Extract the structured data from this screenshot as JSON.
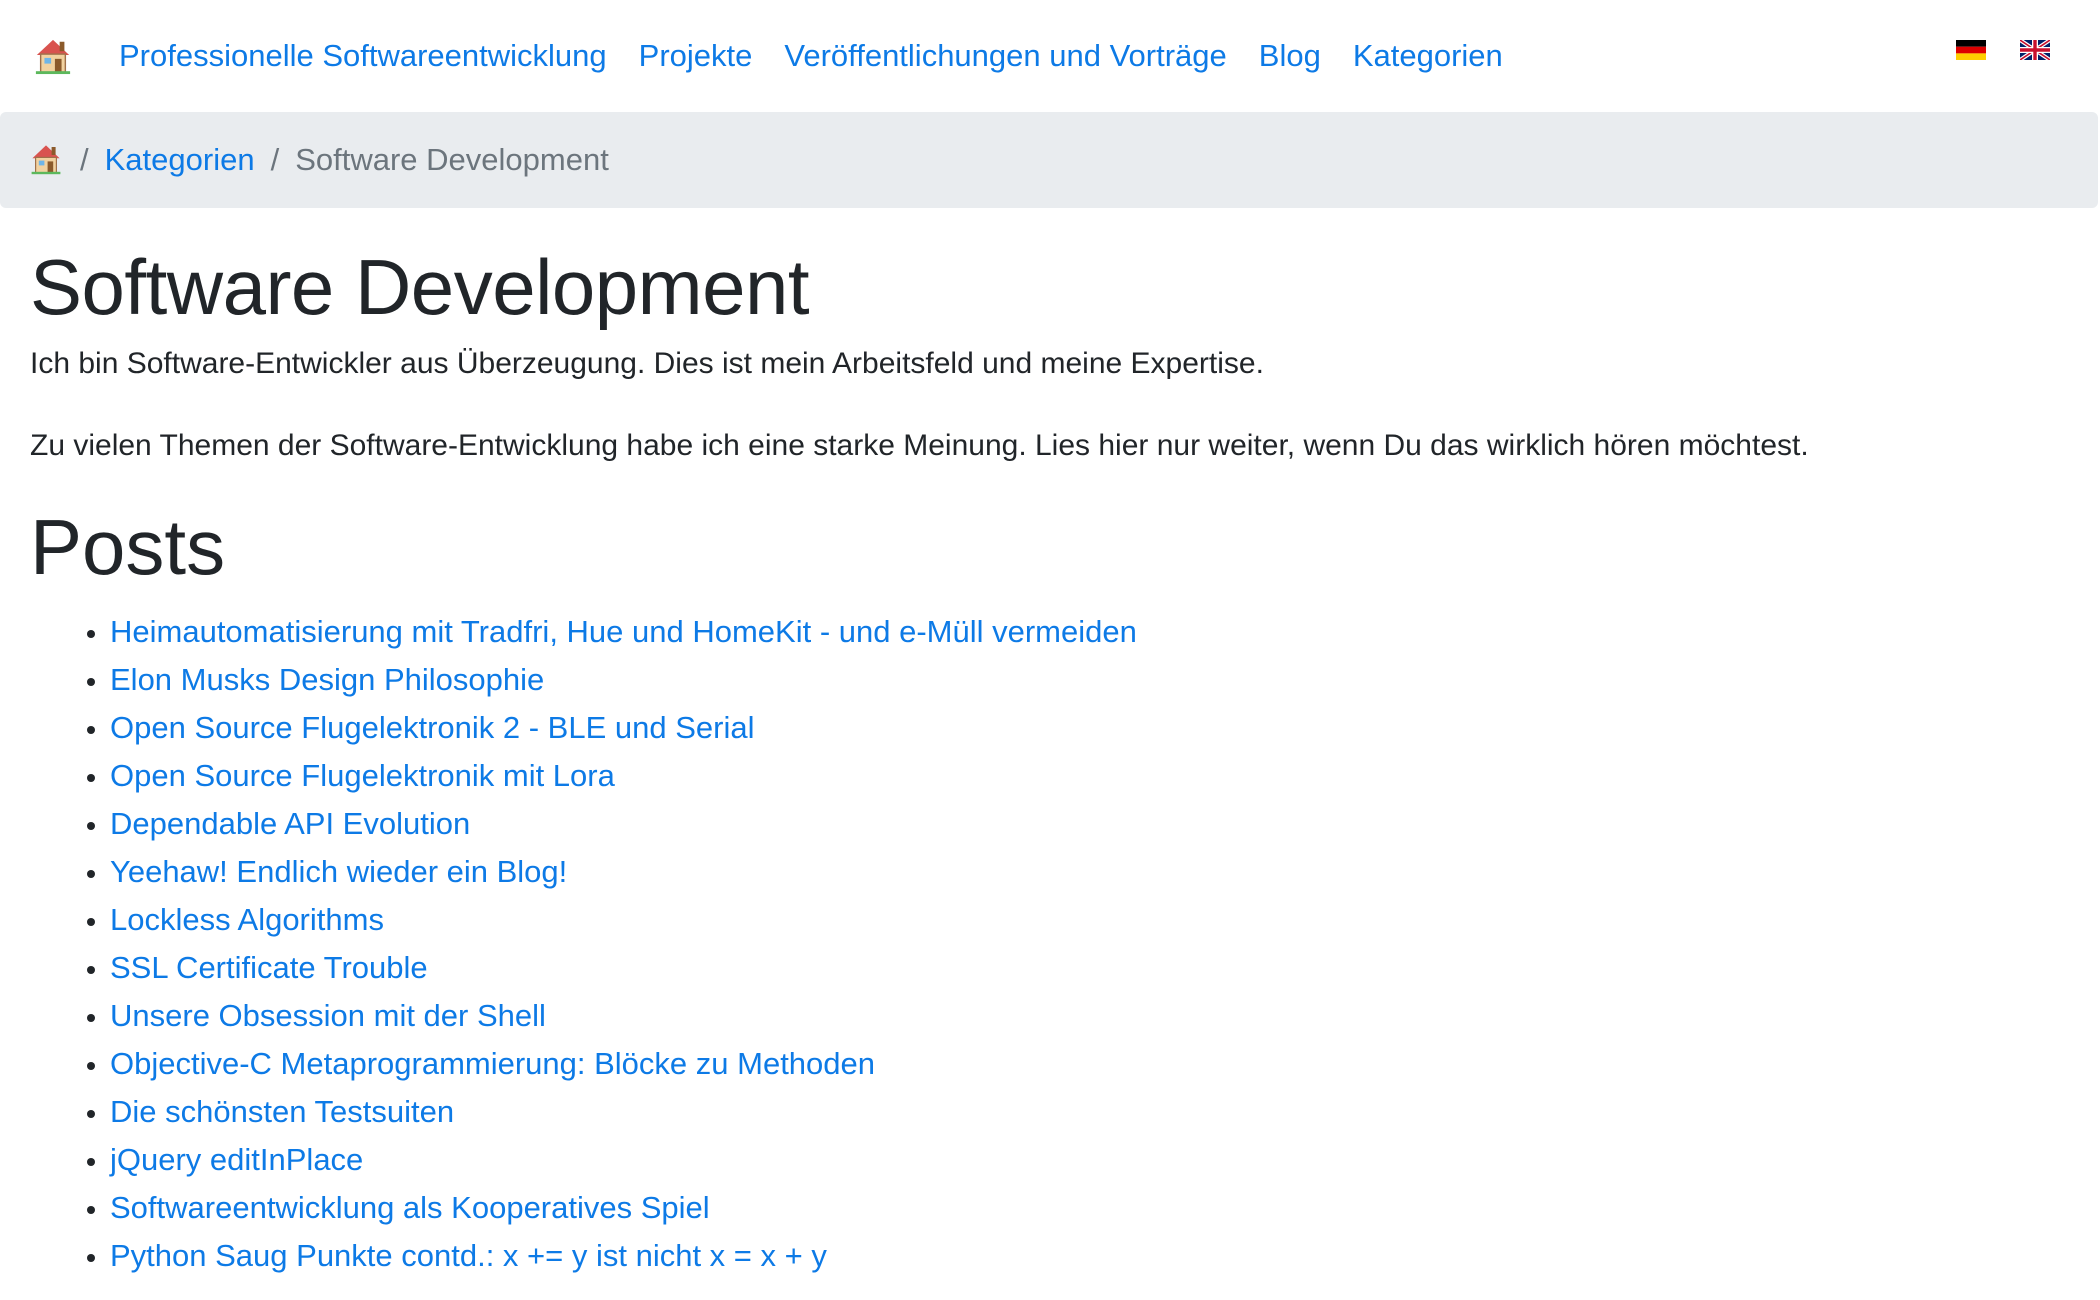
{
  "navbar": {
    "home_icon": "house-icon",
    "links": [
      {
        "label": "Professionelle Softwareentwicklung"
      },
      {
        "label": "Projekte"
      },
      {
        "label": "Veröffentlichungen und Vorträge"
      },
      {
        "label": "Blog"
      },
      {
        "label": "Kategorien"
      }
    ],
    "flags": [
      "german-flag-icon",
      "uk-flag-icon"
    ]
  },
  "breadcrumb": {
    "home_icon": "house-icon",
    "separator": "/",
    "link": "Kategorien",
    "current": "Software Development"
  },
  "main": {
    "title": "Software Development",
    "intro": "Ich bin Software-Entwickler aus Überzeugung. Dies ist mein Arbeitsfeld und meine Expertise.",
    "paragraph": "Zu vielen Themen der Software-Entwicklung habe ich eine starke Meinung. Lies hier nur weiter, wenn Du das wirklich hören möchtest.",
    "posts_heading": "Posts",
    "posts": [
      "Heimautomatisierung mit Tradfri, Hue und HomeKit - und e-Müll vermeiden",
      "Elon Musks Design Philosophie",
      "Open Source Flugelektronik 2 - BLE und Serial",
      "Open Source Flugelektronik mit Lora",
      "Dependable API Evolution",
      "Yeehaw! Endlich wieder ein Blog!",
      "Lockless Algorithms",
      "SSL Certificate Trouble",
      "Unsere Obsession mit der Shell",
      "Objective-C Metaprogrammierung: Blöcke zu Methoden",
      "Die schönsten Testsuiten",
      "jQuery editInPlace",
      "Softwareentwicklung als Kooperatives Spiel",
      "Python Saug Punkte contd.: x += y ist nicht x = x + y"
    ]
  },
  "colors": {
    "link": "#0d7ae6",
    "breadcrumb_bg": "#e9ecef",
    "text": "#212529",
    "muted": "#6c757d"
  }
}
